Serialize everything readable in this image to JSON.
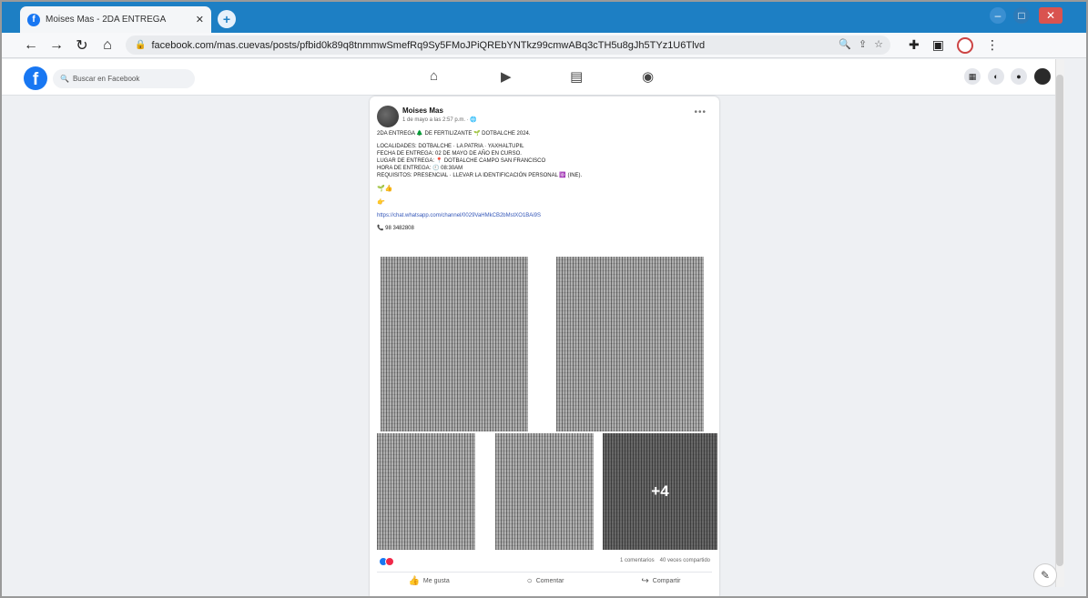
{
  "browser": {
    "tab_title": "Moises Mas - 2DA ENTREGA",
    "url": "facebook.com/mas.cuevas/posts/pfbid0k89q8tnmmwSmefRq9Sy5FMoJPiQREbYNTkz99cmwABq3cTH5u8gJh5TYz1U6Tlvd"
  },
  "fb": {
    "search_placeholder": "Buscar en Facebook"
  },
  "post": {
    "author": "Moises Mas",
    "meta": "1 de mayo a las 2:57 p.m. · 🌐",
    "lines": [
      "2DA ENTREGA 🌲 DE FERTILIZANTE 🌱 DOTBALCHE 2024.",
      "LOCALIDADES: DOTBALCHE · LA PATRIA · YAXHALTUPIL",
      "FECHA DE ENTREGA: 02 DE MAYO DE AÑO EN CURSO.",
      "LUGAR DE ENTREGA: 📍 DOTBALCHE CAMPO SAN FRANCISCO",
      "HORA DE ENTREGA: 🕘 08:30AM",
      "REQUISITOS: PRESENCIAL · LLEVAR LA IDENTIFICACIÓN PERSONAL 🆔 (INE)."
    ],
    "emoji_line_1": "🌱👍",
    "emoji_line_2": "👉",
    "link": "https://chat.whatsapp.com/channel/0029VaHMkCB2bMstXO1BAi9S",
    "phone": "📞 98 3482808",
    "more_photos": "+4",
    "comments": "1 comentarios",
    "shares": "40 veces compartido",
    "actions": {
      "like": "Me gusta",
      "comment": "Comentar",
      "share": "Compartir"
    }
  }
}
